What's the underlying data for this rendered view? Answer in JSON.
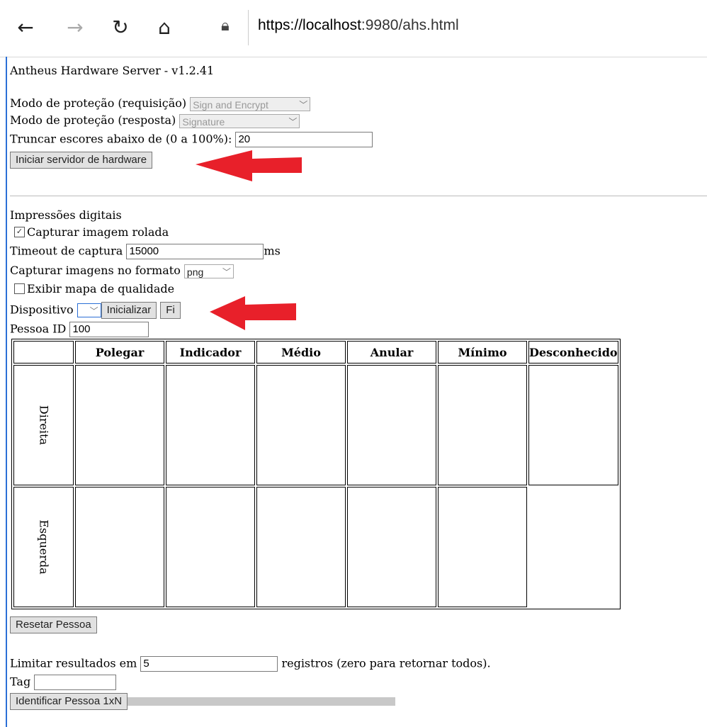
{
  "browser": {
    "url_host": "https://localhost",
    "url_rest": ":9980/ahs.html"
  },
  "header": {
    "title": "Antheus Hardware Server - v1.2.41"
  },
  "config": {
    "req_label": "Modo de proteção (requisição)",
    "req_value": "Sign and Encrypt",
    "resp_label": "Modo de proteção (resposta)",
    "resp_value": "Signature",
    "trunc_label": "Truncar escores abaixo de (0 a 100%):",
    "trunc_value": "20",
    "start_button": "Iniciar servidor de hardware"
  },
  "fingerprints": {
    "section_title": "Impressões digitais",
    "capture_rolled_label": "Capturar imagem rolada",
    "capture_rolled_checked": true,
    "timeout_label": "Timeout de captura",
    "timeout_value": "15000",
    "timeout_unit": "ms",
    "format_label": "Capturar imagens no formato",
    "format_value": "png",
    "quality_map_label": "Exibir mapa de qualidade",
    "quality_map_checked": false,
    "device_label": "Dispositivo",
    "init_button": "Inicializar",
    "finalize_button": "Fi",
    "person_label": "Pessoa ID",
    "person_value": "100"
  },
  "table": {
    "columns": [
      "Polegar",
      "Indicador",
      "Médio",
      "Anular",
      "Mínimo",
      "Desconhecido"
    ],
    "rows": [
      "Direita",
      "Esquerda"
    ]
  },
  "reset_button": "Resetar Pessoa",
  "limit": {
    "label": "Limitar resultados em",
    "value": "5",
    "suffix": "registros (zero para retornar todos)."
  },
  "tag": {
    "label": "Tag",
    "value": ""
  },
  "identify_button": "Identificar Pessoa 1xN",
  "colors": {
    "annotation_arrow": "#e8202a",
    "focus_border": "#2b6fd6"
  }
}
